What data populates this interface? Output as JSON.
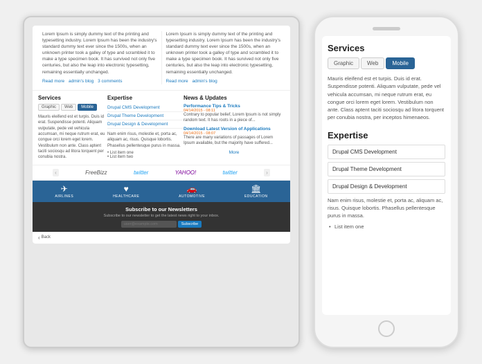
{
  "tablet": {
    "articles": [
      {
        "text": "Lorem Ipsum is simply dummy text of the printing and typesetting industry. Lorem Ipsum has been the industry's standard dummy text ever since the 1500s, when an unknown printer took a galley of type and scrambled it to make a type specimen book. It has survived not only five centuries, but also the leap into electronic typesetting, remaining essentially unchanged.",
        "links": [
          "Read more",
          "admin's blog",
          "3 comments"
        ]
      },
      {
        "text": "Lorem Ipsum is simply dummy text of the printing and typesetting industry. Lorem Ipsum has been the industry's standard dummy text ever since the 1500s, when an unknown printer took a galley of type and scrambled it to make a type specimen book. It has survived not only five centuries, but also the leap into electronic typesetting, remaining essentially unchanged.",
        "links": [
          "Read more",
          "admin's blog"
        ]
      }
    ],
    "services": {
      "title": "Services",
      "tabs": [
        "Graphic",
        "Web",
        "Mobile"
      ],
      "active_tab": "Mobile",
      "text": "Mauris eleifend est et turpis. Duis id erat. Suspendisse potenti. Aliquam vulputate, pede vel vehicula accumsan, mi neque rutrum erat, eu congue orci lorem eget lorem. Vestibulum non ante. Class aptent taciti sociosqu ad litora torquent per conubia nostra."
    },
    "expertise": {
      "title": "Expertise",
      "items": [
        "Drupal CMS Development",
        "Drupal Theme Development",
        "Drupal Design & Development"
      ]
    },
    "news": {
      "title": "News & Updates",
      "items": [
        {
          "title": "Performance Tips & Tricks",
          "date": "04/14/2015 - 08:11",
          "text": "Contrary to popular belief, Lorem Ipsum is not simply random text. It has roots in a piece of..."
        },
        {
          "title": "Download Latest Version of Applications",
          "date": "04/14/2015 - 08:07",
          "text": "There are many variations of passages of Lorem Ipsum available, but the majority have suffered..."
        }
      ],
      "expertise_items": [
        "Nam enim risus, molestie et, porta ac, aliquam ac, risus. Quisque lobortis. Phasellus pellentesque purus in massa.",
        "List item one",
        "List item two"
      ],
      "more": "More"
    },
    "logos": [
      "FreeBizz",
      "twitter",
      "YAHOO!",
      "twitter"
    ],
    "nav": [
      {
        "icon": "✈",
        "label": "AIRLINES"
      },
      {
        "icon": "♥",
        "label": "HEALTHCARE"
      },
      {
        "icon": "🚗",
        "label": "AUTOMOTIVE"
      },
      {
        "icon": "🏛",
        "label": "EDUCATION"
      }
    ],
    "newsletter": {
      "title": "Subscribe to our Newsletters",
      "subtitle": "Subscribe to our newsletter to get the latest news right to your inbox.",
      "placeholder": "user@example.com",
      "button": "Subscribe"
    },
    "back": "Back"
  },
  "phone": {
    "services": {
      "title": "Services",
      "tabs": [
        "Graphic",
        "Web",
        "Mobile"
      ],
      "active_tab": "Mobile",
      "body": "Mauris eleifend est et turpis. Duis id erat. Suspendisse potenti. Aliquam vulputate, pede vel vehicula accumsan, mi neque rutrum erat, eu congue orci lorem eget lorem. Vestibulum non ante. Class aptent taciti sociosqu ad litora torquent per conubia nostra, per inceptos himenaeos."
    },
    "expertise": {
      "title": "Expertise",
      "items": [
        "Drupal CMS Development",
        "Drupal Theme Development",
        "Drupal Design & Development"
      ],
      "body": "Nam enim risus, molestie et, porta ac, aliquam ac, risus. Quisque lobortis. Phasellus pellentesque purus in massa.",
      "list": [
        "List item one"
      ]
    }
  }
}
